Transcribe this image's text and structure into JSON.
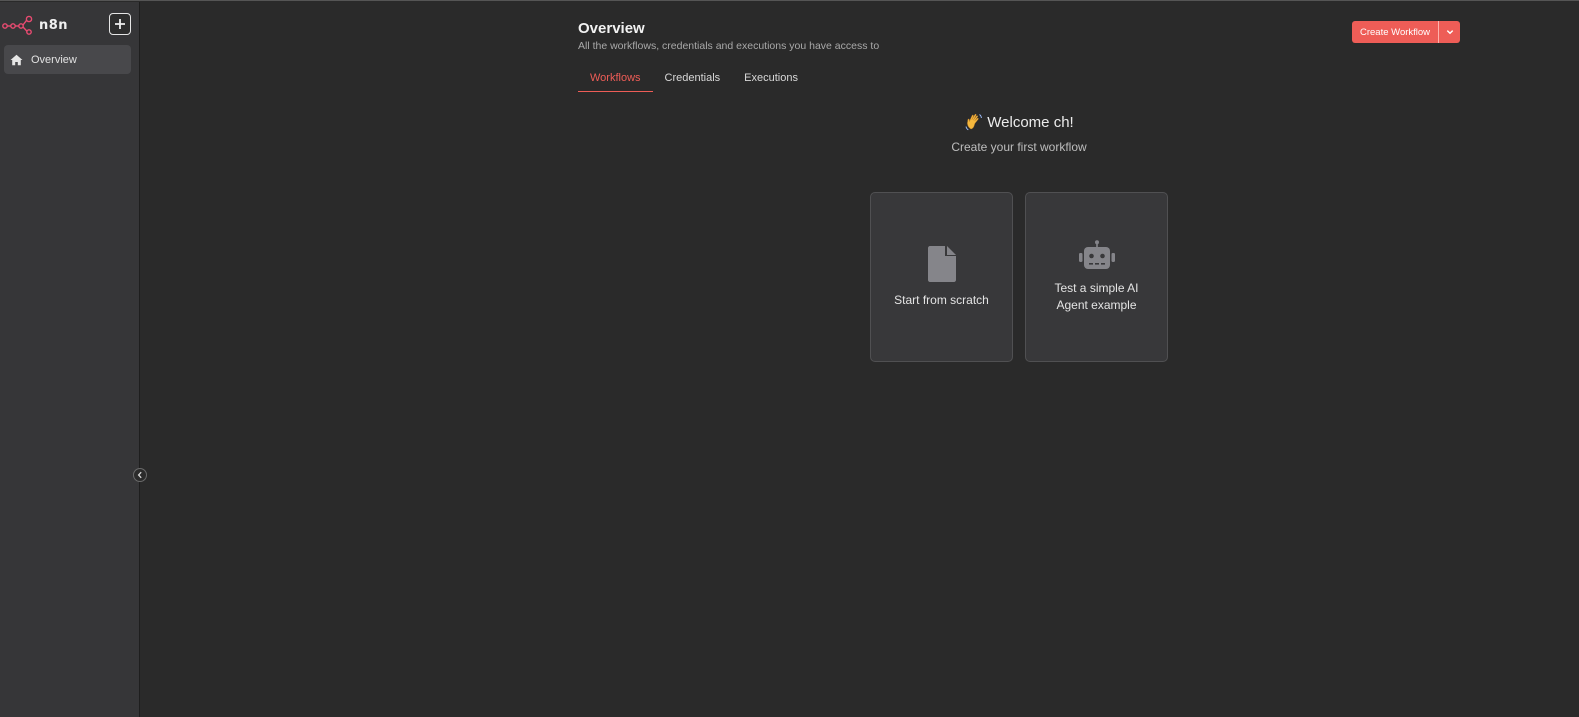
{
  "brand": {
    "name": "n8n",
    "accent": "#ea4b71"
  },
  "sidebar": {
    "items": [
      {
        "label": "Overview",
        "icon": "home-icon",
        "active": true
      }
    ],
    "add_icon": "plus-icon",
    "collapse_icon": "chevron-left-icon"
  },
  "header": {
    "title": "Overview",
    "subtitle": "All the workflows, credentials and executions you have access to",
    "create_button_label": "Create Workflow",
    "create_dropdown_icon": "chevron-down-icon",
    "primary_color": "#ee5d57"
  },
  "tabs": [
    {
      "label": "Workflows",
      "active": true
    },
    {
      "label": "Credentials",
      "active": false
    },
    {
      "label": "Executions",
      "active": false
    }
  ],
  "welcome": {
    "emoji_icon": "waving-hand-icon",
    "heading": "Welcome ch!",
    "subheading": "Create your first workflow"
  },
  "cards": [
    {
      "label": "Start from scratch",
      "icon": "file-icon"
    },
    {
      "label": "Test a simple AI Agent example",
      "icon": "robot-icon"
    }
  ]
}
